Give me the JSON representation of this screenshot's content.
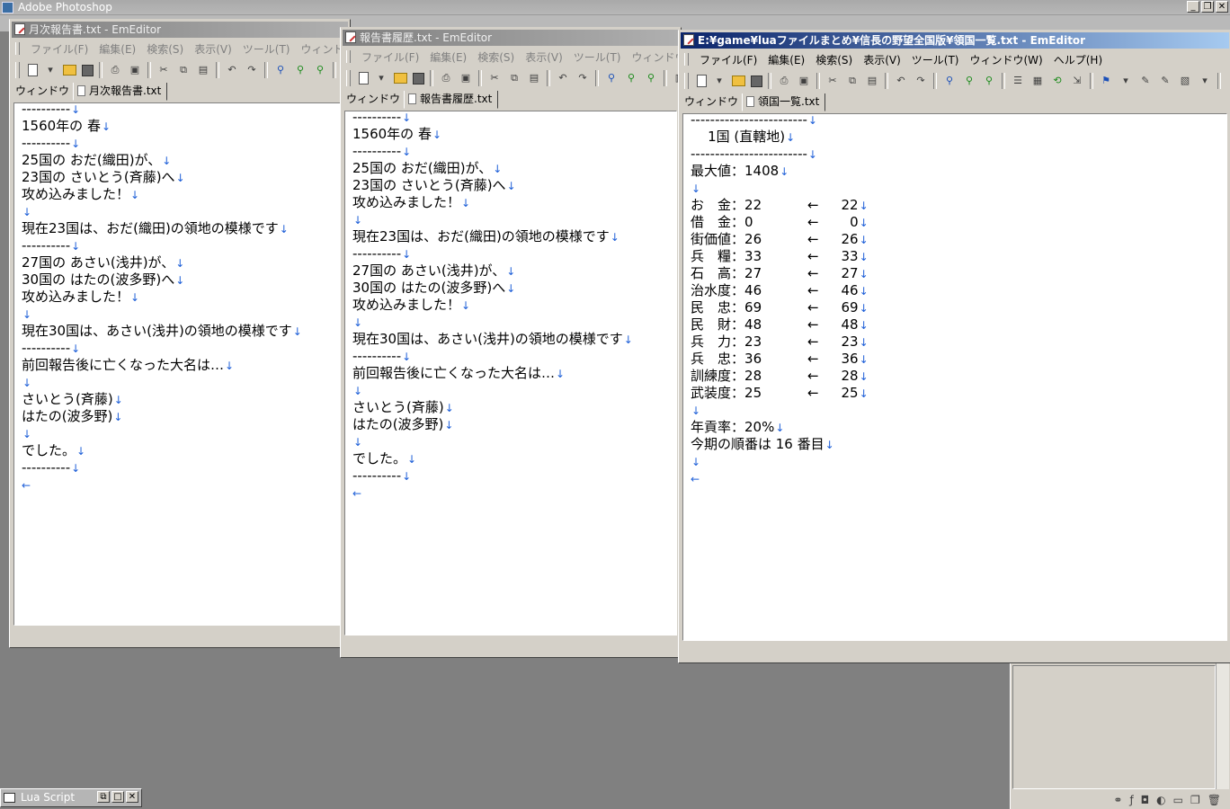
{
  "photoshop": {
    "title": "Adobe Photoshop",
    "controls": [
      "_",
      "❐",
      "✕"
    ]
  },
  "menu": [
    "ファイル(F)",
    "編集(E)",
    "検索(S)",
    "表示(V)",
    "ツール(T)",
    "ウィンドウ(W)",
    "ヘルプ(H)"
  ],
  "tab_prefix": "ウィンドウ",
  "windows": [
    {
      "title": "月次報告書.txt - EmEditor",
      "tab": "月次報告書.txt",
      "lines": [
        "----------",
        "1560年の 春",
        "----------",
        "25国の おだ(織田)が、",
        "23国の さいとう(斉藤)へ",
        "攻め込みました！",
        "",
        "現在23国は、おだ(織田)の領地の模様です",
        "----------",
        "27国の あさい(浅井)が、",
        "30国の はたの(波多野)へ",
        "攻め込みました！",
        "",
        "現在30国は、あさい(浅井)の領地の模様です",
        "----------",
        "前回報告後に亡くなった大名は…",
        "",
        "さいとう(斉藤)",
        "はたの(波多野)",
        "",
        "でした。",
        "----------"
      ],
      "eof": "←"
    },
    {
      "title": "報告書履歴.txt - EmEditor",
      "tab": "報告書履歴.txt",
      "lines": [
        "----------",
        "1560年の 春",
        "----------",
        "25国の おだ(織田)が、",
        "23国の さいとう(斉藤)へ",
        "攻め込みました！",
        "",
        "現在23国は、おだ(織田)の領地の模様です",
        "----------",
        "27国の あさい(浅井)が、",
        "30国の はたの(波多野)へ",
        "攻め込みました！",
        "",
        "現在30国は、あさい(浅井)の領地の模様です",
        "----------",
        "前回報告後に亡くなった大名は…",
        "",
        "さいとう(斉藤)",
        "はたの(波多野)",
        "",
        "でした。",
        "----------"
      ],
      "eof": "←"
    },
    {
      "title": "E:¥game¥luaファイルまとめ¥信長の野望全国版¥領国一覧.txt - EmEditor",
      "tab": "領国一覧.txt",
      "header_lines": [
        "------------------------",
        "    1国 (直轄地)",
        "------------------------",
        "最大値：1408",
        ""
      ],
      "stats": [
        {
          "label": "お　金",
          "value": "22",
          "arrow": "←",
          "prev": "22"
        },
        {
          "label": "借　金",
          "value": "0",
          "arrow": "←",
          "prev": "0"
        },
        {
          "label": "街価値",
          "value": "26",
          "arrow": "←",
          "prev": "26"
        },
        {
          "label": "兵　糧",
          "value": "33",
          "arrow": "←",
          "prev": "33"
        },
        {
          "label": "石　高",
          "value": "27",
          "arrow": "←",
          "prev": "27"
        },
        {
          "label": "治水度",
          "value": "46",
          "arrow": "←",
          "prev": "46"
        },
        {
          "label": "民　忠",
          "value": "69",
          "arrow": "←",
          "prev": "69"
        },
        {
          "label": "民　財",
          "value": "48",
          "arrow": "←",
          "prev": "48"
        },
        {
          "label": "兵　力",
          "value": "23",
          "arrow": "←",
          "prev": "23"
        },
        {
          "label": "兵　忠",
          "value": "36",
          "arrow": "←",
          "prev": "36"
        },
        {
          "label": "訓練度",
          "value": "28",
          "arrow": "←",
          "prev": "28"
        },
        {
          "label": "武装度",
          "value": "25",
          "arrow": "←",
          "prev": "25"
        }
      ],
      "footer_lines": [
        "",
        "年貢率：20%",
        "今期の順番は 16 番目",
        ""
      ],
      "eof": "←"
    }
  ],
  "lua_script": {
    "title": "Lua Script",
    "controls": [
      "⧉",
      "□",
      "✕"
    ]
  },
  "newline_mark": "↓",
  "colors": {
    "newline_mark": "#1e5fd8",
    "active_title": "#0a246a"
  }
}
